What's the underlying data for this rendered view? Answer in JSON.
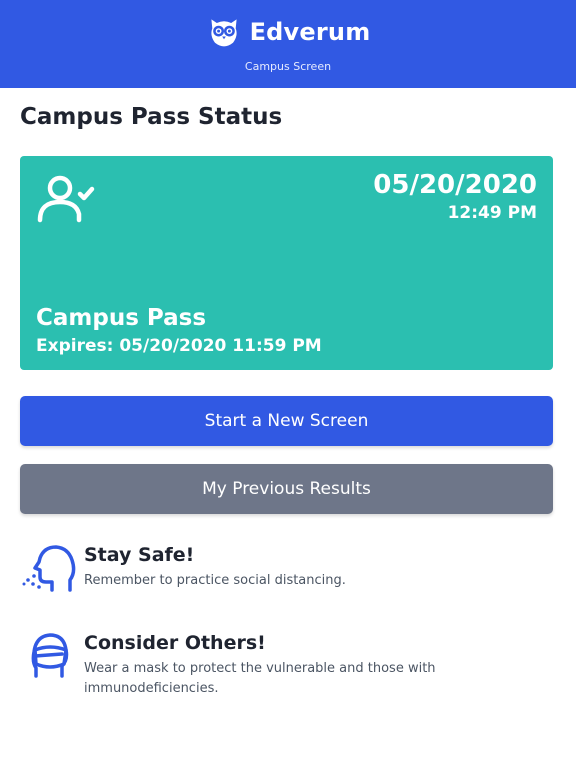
{
  "colors": {
    "brand_blue": "#3159e3",
    "pass_teal": "#2bbfb0",
    "secondary_gray": "#6e7689",
    "title_dark": "#1f2430"
  },
  "header": {
    "app_name": "Edverum",
    "subtitle": "Campus Screen",
    "logo_icon": "owl-logo-icon"
  },
  "main": {
    "title": "Campus Pass Status"
  },
  "pass_card": {
    "icon": "user-check-icon",
    "date": "05/20/2020",
    "time": "12:49 PM",
    "name": "Campus Pass",
    "expires": "Expires: 05/20/2020 11:59 PM"
  },
  "buttons": {
    "new_screen_label": "Start a New Screen",
    "previous_results_label": "My Previous Results"
  },
  "tips": [
    {
      "icon": "social-distance-icon",
      "title": "Stay Safe!",
      "text": "Remember to practice social distancing."
    },
    {
      "icon": "face-mask-icon",
      "title": "Consider Others!",
      "text": "Wear a mask to protect the vulnerable and those with immunodeficiencies."
    }
  ]
}
